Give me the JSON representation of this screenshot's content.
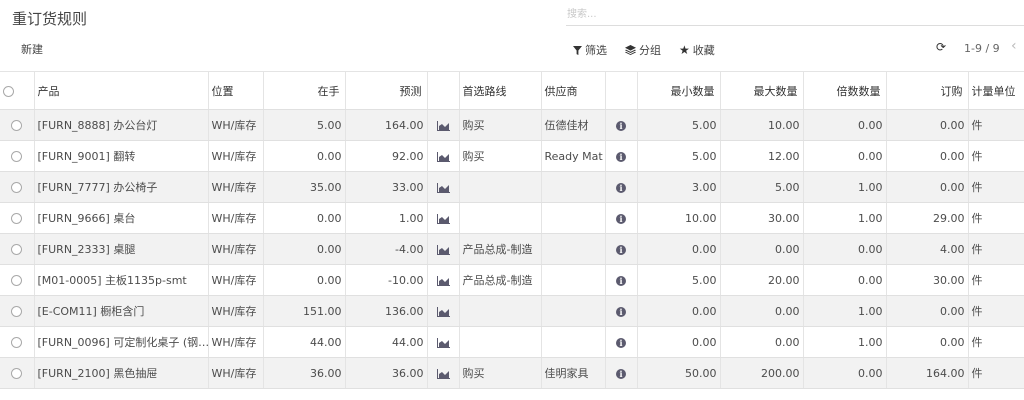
{
  "page": {
    "title": "重订货规则",
    "new_label": "新建"
  },
  "search": {
    "placeholder": "搜索..."
  },
  "toolbar": {
    "filter_label": "筛选",
    "group_label": "分组",
    "favorite_label": "收藏"
  },
  "pager": {
    "range": "1-9 / 9"
  },
  "columns": {
    "product": "产品",
    "location": "位置",
    "on_hand": "在手",
    "forecast": "预测",
    "route": "首选路线",
    "vendor": "供应商",
    "min_qty": "最小数量",
    "max_qty": "最大数量",
    "multiple_qty": "倍数数量",
    "to_order": "订购",
    "uom": "计量单位"
  },
  "rows": [
    {
      "product": "[FURN_8888] 办公台灯",
      "location": "WH/库存",
      "on_hand": "5.00",
      "forecast": "164.00",
      "route": "购买",
      "vendor": "伍德佳材",
      "min_qty": "5.00",
      "max_qty": "10.00",
      "multiple_qty": "0.00",
      "to_order": "0.00",
      "uom": "件"
    },
    {
      "product": "[FURN_9001] 翻转",
      "location": "WH/库存",
      "on_hand": "0.00",
      "forecast": "92.00",
      "route": "购买",
      "vendor": "Ready Mat",
      "min_qty": "5.00",
      "max_qty": "12.00",
      "multiple_qty": "0.00",
      "to_order": "0.00",
      "uom": "件"
    },
    {
      "product": "[FURN_7777] 办公椅子",
      "location": "WH/库存",
      "on_hand": "35.00",
      "forecast": "33.00",
      "route": "",
      "vendor": "",
      "min_qty": "3.00",
      "max_qty": "5.00",
      "multiple_qty": "1.00",
      "to_order": "0.00",
      "uom": "件"
    },
    {
      "product": "[FURN_9666] 桌台",
      "location": "WH/库存",
      "on_hand": "0.00",
      "forecast": "1.00",
      "route": "",
      "vendor": "",
      "min_qty": "10.00",
      "max_qty": "30.00",
      "multiple_qty": "1.00",
      "to_order": "29.00",
      "uom": "件"
    },
    {
      "product": "[FURN_2333] 桌腿",
      "location": "WH/库存",
      "on_hand": "0.00",
      "forecast": "-4.00",
      "route": "产品总成-制造",
      "vendor": "",
      "min_qty": "0.00",
      "max_qty": "0.00",
      "multiple_qty": "0.00",
      "to_order": "4.00",
      "uom": "件"
    },
    {
      "product": "[M01-0005] 主板1135p-smt",
      "location": "WH/库存",
      "on_hand": "0.00",
      "forecast": "-10.00",
      "route": "产品总成-制造",
      "vendor": "",
      "min_qty": "5.00",
      "max_qty": "20.00",
      "multiple_qty": "0.00",
      "to_order": "30.00",
      "uom": "件"
    },
    {
      "product": "[E-COM11] 橱柜含门",
      "location": "WH/库存",
      "on_hand": "151.00",
      "forecast": "136.00",
      "route": "",
      "vendor": "",
      "min_qty": "0.00",
      "max_qty": "0.00",
      "multiple_qty": "1.00",
      "to_order": "0.00",
      "uom": "件"
    },
    {
      "product": "[FURN_0096] 可定制化桌子 (钢…",
      "location": "WH/库存",
      "on_hand": "44.00",
      "forecast": "44.00",
      "route": "",
      "vendor": "",
      "min_qty": "0.00",
      "max_qty": "0.00",
      "multiple_qty": "1.00",
      "to_order": "0.00",
      "uom": "件"
    },
    {
      "product": "[FURN_2100] 黑色抽屉",
      "location": "WH/库存",
      "on_hand": "36.00",
      "forecast": "36.00",
      "route": "购买",
      "vendor": "佳明家具",
      "min_qty": "50.00",
      "max_qty": "200.00",
      "multiple_qty": "0.00",
      "to_order": "164.00",
      "uom": "件"
    }
  ],
  "icons": {
    "forecast": "area-chart-icon",
    "info": "info-circle-icon",
    "filter": "filter-icon",
    "group": "layers-icon",
    "favorite": "star-icon",
    "refresh": "refresh-icon",
    "prev": "chevron-left-icon"
  },
  "colors": {
    "accent": "#5b5a6e",
    "row_alt": "#f2f2f2"
  }
}
